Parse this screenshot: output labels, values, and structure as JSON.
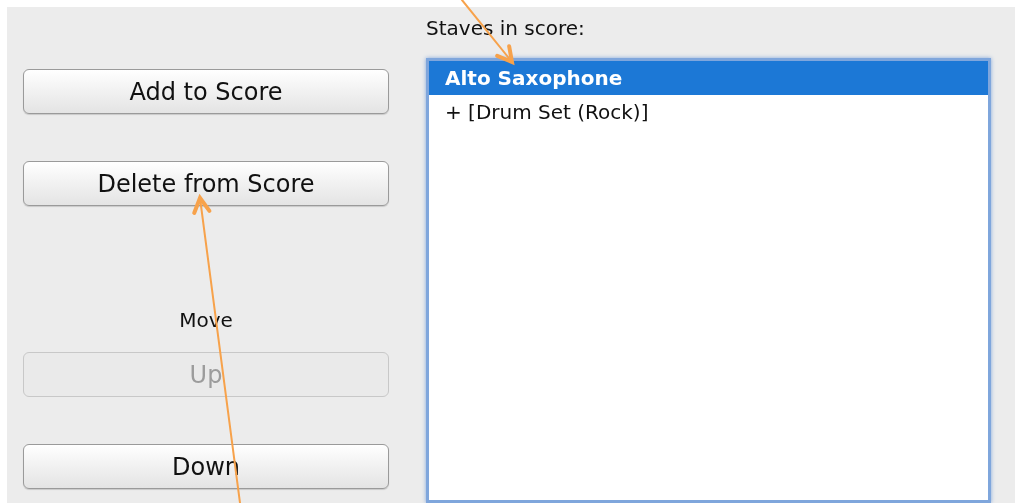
{
  "buttons": [
    {
      "label": "Add to Score",
      "disabled": false
    },
    {
      "label": "Delete from Score",
      "disabled": false
    }
  ],
  "move": {
    "label": "Move",
    "buttons": [
      {
        "label": "Up",
        "disabled": true
      },
      {
        "label": "Down",
        "disabled": false
      }
    ]
  },
  "staves": {
    "label": "Staves in score:",
    "items": [
      {
        "label": "Alto Saxophone",
        "selected": true
      },
      {
        "label": "+ [Drum Set (Rock)]",
        "selected": false
      }
    ]
  },
  "annotations": [
    {
      "kind": "arrow"
    },
    {
      "kind": "arrow"
    }
  ]
}
